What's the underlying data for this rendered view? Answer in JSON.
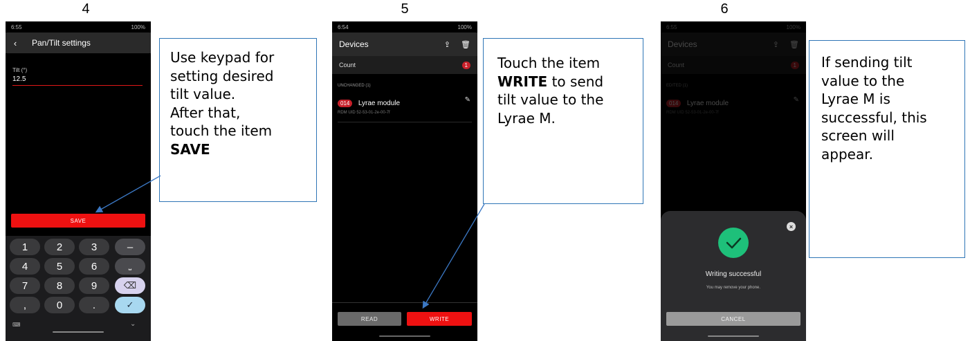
{
  "steps": [
    {
      "number": "4",
      "status": {
        "time": "6:55",
        "right": "100%"
      },
      "header": {
        "title": "Pan/Tilt settings"
      },
      "field": {
        "label": "Tilt (°)",
        "value": "12.5"
      },
      "save_label": "SAVE",
      "keypad": [
        "1",
        "2",
        "3",
        "–",
        "4",
        "5",
        "6",
        "⎵",
        "7",
        "8",
        "9",
        "⌫",
        ",",
        "0",
        ".",
        "✓"
      ],
      "callout": {
        "line1": "Use keypad for",
        "line2": "setting desired",
        "line3": "tilt value.",
        "line4": "After that,",
        "line5": "touch the item",
        "line6": "SAVE"
      }
    },
    {
      "number": "5",
      "status": {
        "time": "6:54",
        "right": "100%"
      },
      "header": {
        "title": "Devices"
      },
      "count_label": "Count",
      "count_value": "1",
      "section_label": "UNCHANGED (1)",
      "device": {
        "badge": "014",
        "name": "Lyrae module",
        "rdm": "RDM UID 52-53-01-2e-00-7f"
      },
      "read_label": "READ",
      "write_label": "WRITE",
      "callout": {
        "line1": "Touch the item",
        "line2_bold": "WRITE",
        "line2_rest": " to send",
        "line3": "tilt value to the",
        "line4": "Lyrae M."
      }
    },
    {
      "number": "6",
      "status": {
        "time": "6:55",
        "right": "100%"
      },
      "header": {
        "title": "Devices"
      },
      "count_label": "Count",
      "count_value": "1",
      "section_label": "EDITED (1)",
      "device": {
        "badge": "014",
        "name": "Lyrae module",
        "rdm": "RDM UID 52-53-01-2e-00-7f"
      },
      "dialog": {
        "title": "Writing successful",
        "subtitle": "You may remove your phone.",
        "cancel_label": "CANCEL"
      },
      "callout": {
        "line1": "If sending tilt",
        "line2": "value to the",
        "line3": "Lyrae M is",
        "line4": "successful, this",
        "line5": "screen will",
        "line6": "appear."
      }
    }
  ],
  "colors": {
    "accent_red": "#ee1111",
    "callout_border": "#2e75b6",
    "success_green": "#1ec07a"
  }
}
